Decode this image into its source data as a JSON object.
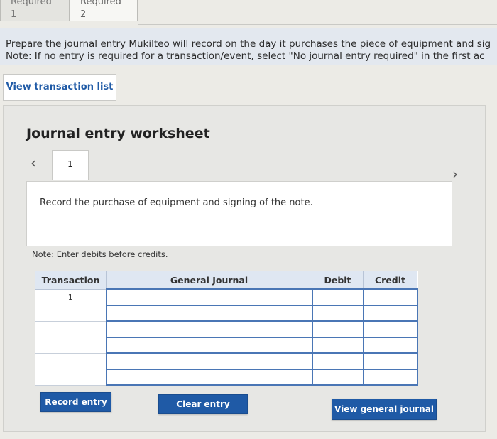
{
  "tabs": [
    {
      "label": "Required 1"
    },
    {
      "label": "Required 2"
    }
  ],
  "instructions": {
    "line1": "Prepare the journal entry Mukilteo will record on the day it purchases the piece of equipment and sig",
    "line2": "Note: If no entry is required for a transaction/event, select \"No journal entry required\" in the first ac"
  },
  "view_transaction_list_label": "View transaction list",
  "worksheet": {
    "title": "Journal entry worksheet",
    "current_tab": "1",
    "prev_icon": "chevron-left-icon",
    "next_icon": "chevron-right-icon",
    "description": "Record the purchase of equipment and signing of the note.",
    "note": "Note: Enter debits before credits."
  },
  "table": {
    "headers": [
      "Transaction",
      "General Journal",
      "Debit",
      "Credit"
    ],
    "rows": [
      {
        "transaction": "1",
        "general_journal": "",
        "debit": "",
        "credit": ""
      },
      {
        "transaction": "",
        "general_journal": "",
        "debit": "",
        "credit": ""
      },
      {
        "transaction": "",
        "general_journal": "",
        "debit": "",
        "credit": ""
      },
      {
        "transaction": "",
        "general_journal": "",
        "debit": "",
        "credit": ""
      },
      {
        "transaction": "",
        "general_journal": "",
        "debit": "",
        "credit": ""
      },
      {
        "transaction": "",
        "general_journal": "",
        "debit": "",
        "credit": ""
      }
    ]
  },
  "buttons": {
    "record_entry": "Record entry",
    "clear_entry": "Clear entry",
    "view_general_journal": "View general journal"
  },
  "colors": {
    "primary_button": "#1f5aa6",
    "table_header": "#dfe7f2",
    "input_border": "#4a76b5"
  }
}
